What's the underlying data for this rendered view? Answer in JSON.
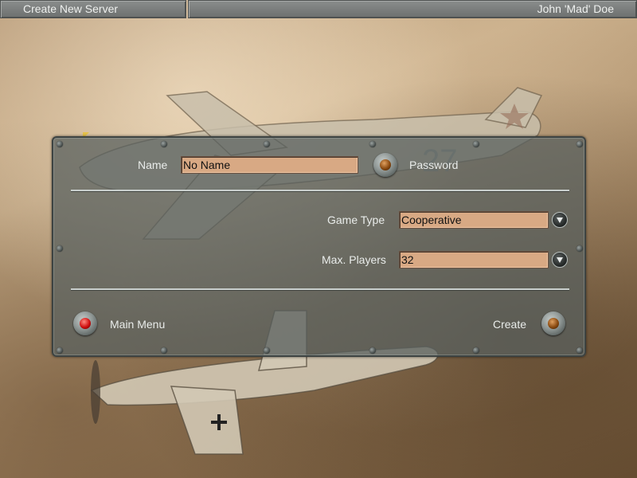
{
  "header": {
    "title": "Create New Server",
    "user": "John 'Mad' Doe"
  },
  "form": {
    "name_label": "Name",
    "name_value": "No Name",
    "password_label": "Password",
    "game_type_label": "Game Type",
    "game_type_value": "Cooperative",
    "max_players_label": "Max. Players",
    "max_players_value": "32"
  },
  "footer": {
    "main_menu_label": "Main Menu",
    "create_label": "Create"
  },
  "icons": {
    "password_toggle": "amber-knob-icon",
    "main_menu": "red-knob-icon",
    "create": "amber-knob-icon",
    "dropdown": "chevron-down-icon"
  }
}
